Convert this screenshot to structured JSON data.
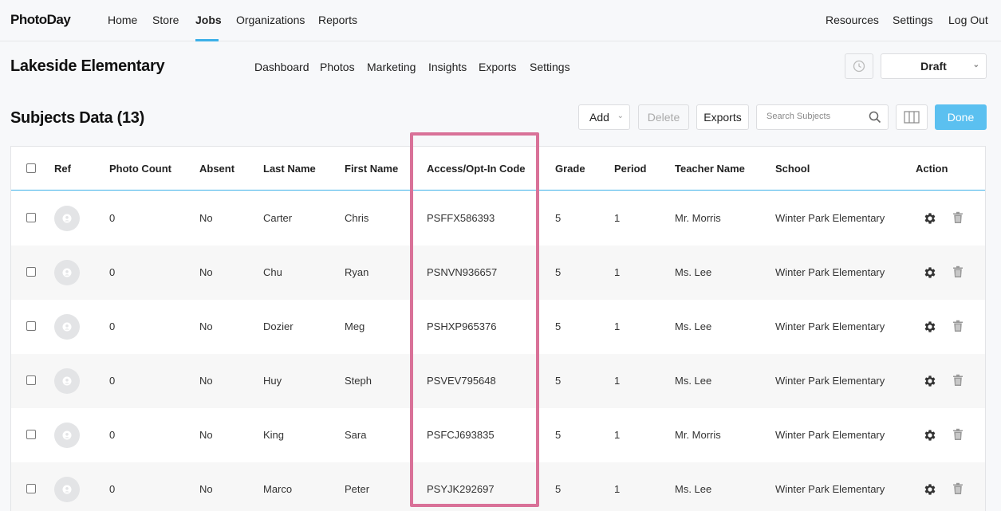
{
  "brand": {
    "logo": "PhotoDay"
  },
  "topnav": {
    "left": [
      "Home",
      "Store",
      "Jobs",
      "Organizations",
      "Reports"
    ],
    "right": [
      "Resources",
      "Settings",
      "Log Out"
    ],
    "active": "Jobs"
  },
  "job": {
    "title": "Lakeside Elementary",
    "subnav": [
      "Dashboard",
      "Photos",
      "Marketing",
      "Insights",
      "Exports",
      "Settings"
    ],
    "status": "Draft"
  },
  "subjects": {
    "title": "Subjects Data (13)",
    "add_label": "Add",
    "delete_label": "Delete",
    "exports_label": "Exports",
    "search_placeholder": "Search Subjects",
    "done_label": "Done"
  },
  "table": {
    "headers": [
      "Ref",
      "Photo Count",
      "Absent",
      "Last Name",
      "First Name",
      "Access/Opt-In Code",
      "Grade",
      "Period",
      "Teacher Name",
      "School",
      "Action"
    ],
    "rows": [
      {
        "photo_count": "0",
        "absent": "No",
        "last": "Carter",
        "first": "Chris",
        "code": "PSFFX586393",
        "grade": "5",
        "period": "1",
        "teacher": "Mr. Morris",
        "school": "Winter Park Elementary"
      },
      {
        "photo_count": "0",
        "absent": "No",
        "last": "Chu",
        "first": "Ryan",
        "code": "PSNVN936657",
        "grade": "5",
        "period": "1",
        "teacher": "Ms. Lee",
        "school": "Winter Park Elementary"
      },
      {
        "photo_count": "0",
        "absent": "No",
        "last": "Dozier",
        "first": "Meg",
        "code": "PSHXP965376",
        "grade": "5",
        "period": "1",
        "teacher": "Ms. Lee",
        "school": "Winter Park Elementary"
      },
      {
        "photo_count": "0",
        "absent": "No",
        "last": "Huy",
        "first": "Steph",
        "code": "PSVEV795648",
        "grade": "5",
        "period": "1",
        "teacher": "Ms. Lee",
        "school": "Winter Park Elementary"
      },
      {
        "photo_count": "0",
        "absent": "No",
        "last": "King",
        "first": "Sara",
        "code": "PSFCJ693835",
        "grade": "5",
        "period": "1",
        "teacher": "Mr. Morris",
        "school": "Winter Park Elementary"
      },
      {
        "photo_count": "0",
        "absent": "No",
        "last": "Marco",
        "first": "Peter",
        "code": "PSYJK292697",
        "grade": "5",
        "period": "1",
        "teacher": "Ms. Lee",
        "school": "Winter Park Elementary"
      }
    ]
  },
  "colors": {
    "accent": "#3db0e8",
    "done_button": "#5bc0f0",
    "highlight": "#d97198"
  },
  "icons": [
    "history-icon",
    "search-icon",
    "columns-icon",
    "user-placeholder-icon",
    "gear-icon",
    "trash-icon"
  ]
}
